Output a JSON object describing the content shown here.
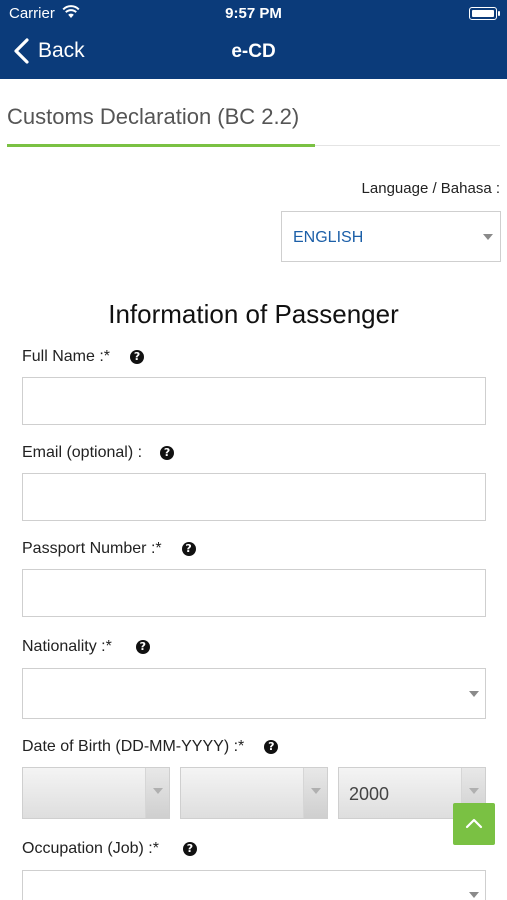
{
  "status_bar": {
    "carrier": "Carrier",
    "time": "9:57 PM"
  },
  "nav": {
    "back_label": "Back",
    "title": "e-CD"
  },
  "page": {
    "heading": "Customs Declaration (BC 2.2)"
  },
  "language": {
    "label": "Language / Bahasa :",
    "selected": "ENGLISH"
  },
  "section": {
    "title": "Information of Passenger"
  },
  "fields": {
    "full_name": {
      "label": "Full Name :*",
      "value": ""
    },
    "email": {
      "label": "Email (optional) :",
      "value": ""
    },
    "passport": {
      "label": "Passport Number :*",
      "value": ""
    },
    "nationality": {
      "label": "Nationality :*",
      "value": ""
    },
    "dob": {
      "label": "Date of Birth (DD-MM-YYYY) :*",
      "day": "",
      "month": "",
      "year": "2000"
    },
    "occupation": {
      "label": "Occupation (Job) :*",
      "value": ""
    }
  },
  "help_glyph": "?",
  "colors": {
    "header": "#0b3b7a",
    "accent_green": "#7ac143",
    "link_blue": "#1c5fa8"
  }
}
